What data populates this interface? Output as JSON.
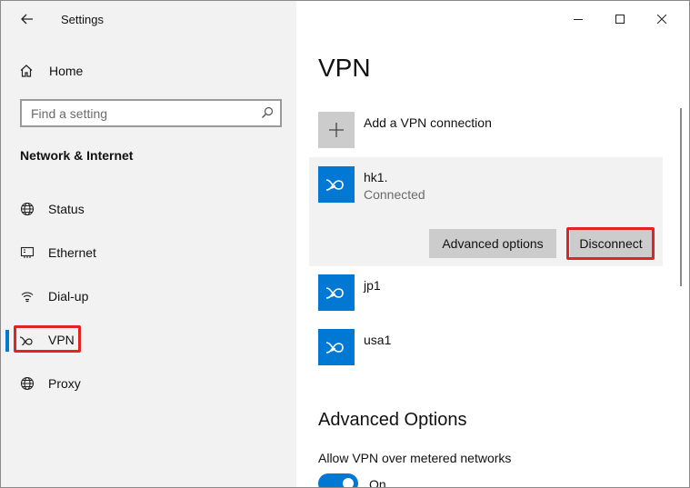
{
  "window": {
    "title": "Settings"
  },
  "sidebar": {
    "home_label": "Home",
    "search_placeholder": "Find a setting",
    "section_title": "Network & Internet",
    "items": [
      {
        "label": "Status",
        "icon": "globe-icon"
      },
      {
        "label": "Ethernet",
        "icon": "ethernet-icon"
      },
      {
        "label": "Dial-up",
        "icon": "dialup-icon"
      },
      {
        "label": "VPN",
        "icon": "vpn-icon",
        "active": true
      },
      {
        "label": "Proxy",
        "icon": "globe-icon"
      }
    ]
  },
  "main": {
    "title": "VPN",
    "add_label": "Add a VPN connection",
    "connections": [
      {
        "name": "hk1.",
        "status": "Connected",
        "expanded": true
      },
      {
        "name": "jp1"
      },
      {
        "name": "usa1"
      }
    ],
    "advanced_options_button": "Advanced options",
    "disconnect_button": "Disconnect",
    "advanced_title": "Advanced Options",
    "metered_label": "Allow VPN over metered networks",
    "metered_state": "On"
  },
  "colors": {
    "accent": "#0078d4",
    "highlight": "#e02424",
    "sidebar_bg": "#f2f2f2",
    "button_bg": "#cccccc"
  }
}
